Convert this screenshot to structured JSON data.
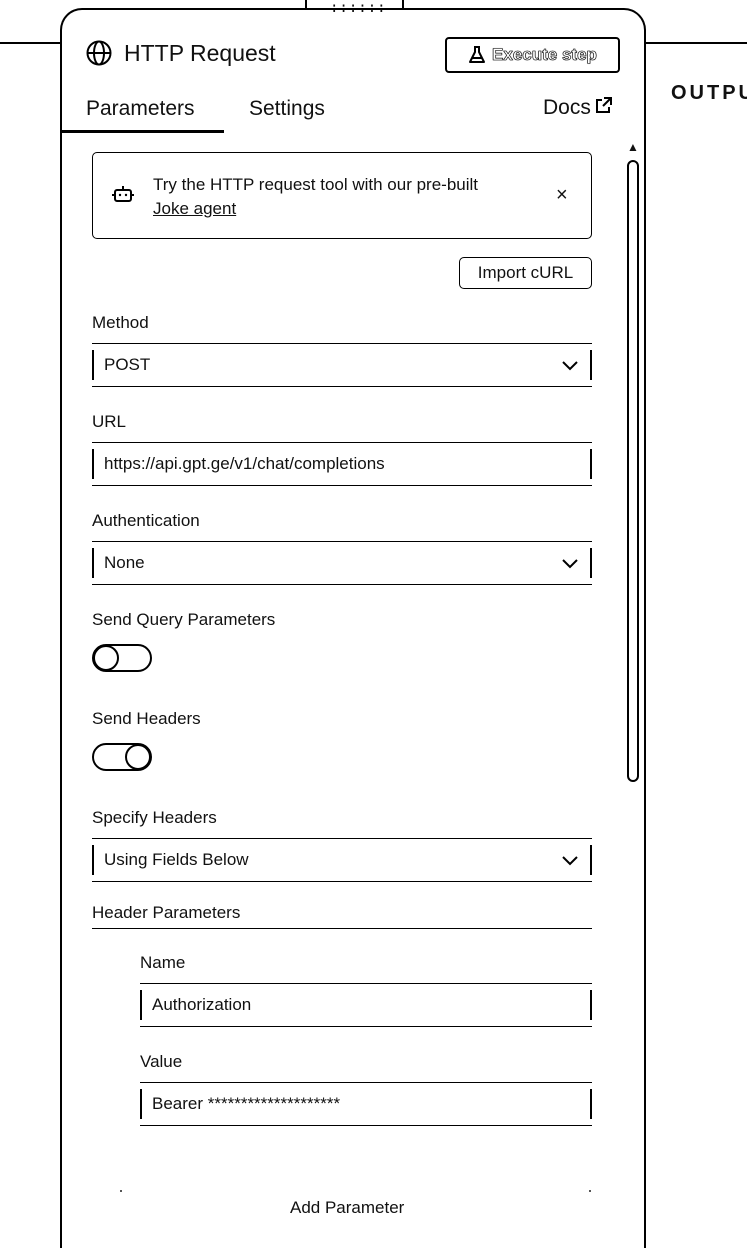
{
  "panel": {
    "title": "HTTP Request",
    "title_icon": "globe-icon",
    "execute_label": "Execute step",
    "execute_icon": "flask-icon",
    "drag_handle": "::::::",
    "output_label": "OUTPU"
  },
  "tabs": {
    "parameters": "Parameters",
    "settings": "Settings",
    "active": "Parameters",
    "docs": "Docs",
    "docs_icon": "external-link-icon"
  },
  "banner": {
    "icon": "robot-icon",
    "text": "Try the HTTP request tool with our pre-built",
    "link": "Joke agent",
    "close": "×"
  },
  "import_curl": "Import cURL",
  "method": {
    "label": "Method",
    "value": "POST"
  },
  "url": {
    "label": "URL",
    "value": "https://api.gpt.ge/v1/chat/completions"
  },
  "authentication": {
    "label": "Authentication",
    "value": "None"
  },
  "send_query": {
    "label": "Send Query Parameters",
    "enabled": false
  },
  "send_headers": {
    "label": "Send Headers",
    "enabled": true
  },
  "specify_headers": {
    "label": "Specify Headers",
    "value": "Using Fields Below"
  },
  "header_parameters": {
    "label": "Header Parameters",
    "name_label": "Name",
    "name_value": "Authorization",
    "value_label": "Value",
    "value_value": "Bearer ********************"
  },
  "add_parameter": "Add Parameter"
}
